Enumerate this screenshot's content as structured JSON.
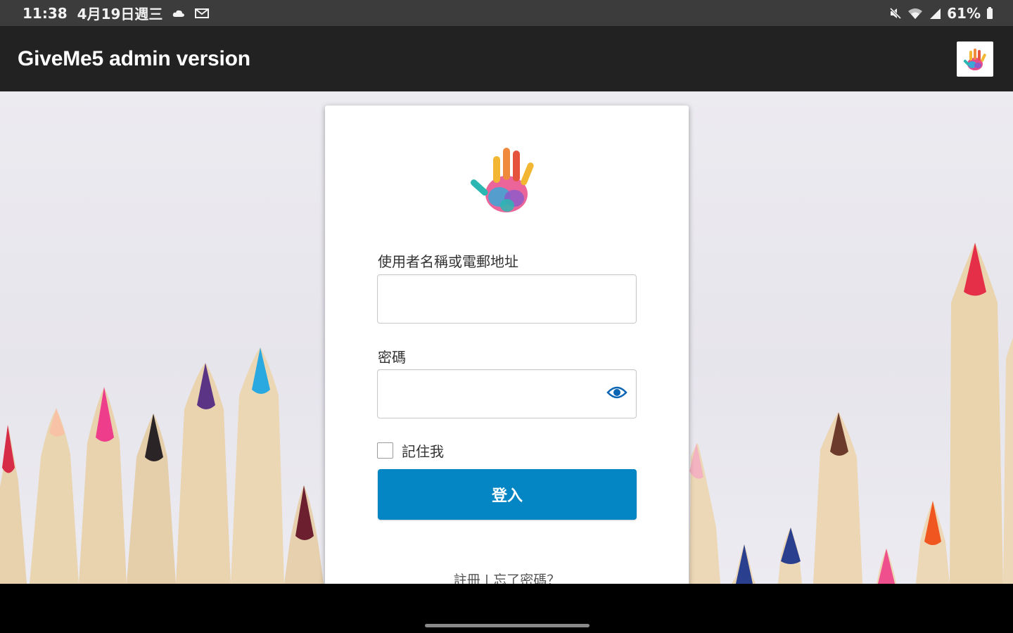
{
  "status_bar": {
    "time": "11:38",
    "date": "4月19日週三",
    "battery": "61%",
    "icons": [
      "cloud-icon",
      "mail-icon",
      "mute-icon",
      "wifi-icon",
      "signal-icon",
      "battery-icon"
    ]
  },
  "app_bar": {
    "title": "GiveMe5 admin version",
    "logo_icon": "handprint-logo-icon"
  },
  "login_form": {
    "username_label": "使用者名稱或電郵地址",
    "username_value": "",
    "password_label": "密碼",
    "password_value": "",
    "show_password_icon": "eye-icon",
    "remember_label": "記住我",
    "remember_checked": false,
    "login_button": "登入",
    "links": "註冊 | 忘了密碼？"
  },
  "colors": {
    "status_bar": "#3c3c3c",
    "app_bar": "#222222",
    "background": "#ecebf0",
    "primary_button": "#0386c3",
    "eye_icon": "#0a66b5"
  }
}
